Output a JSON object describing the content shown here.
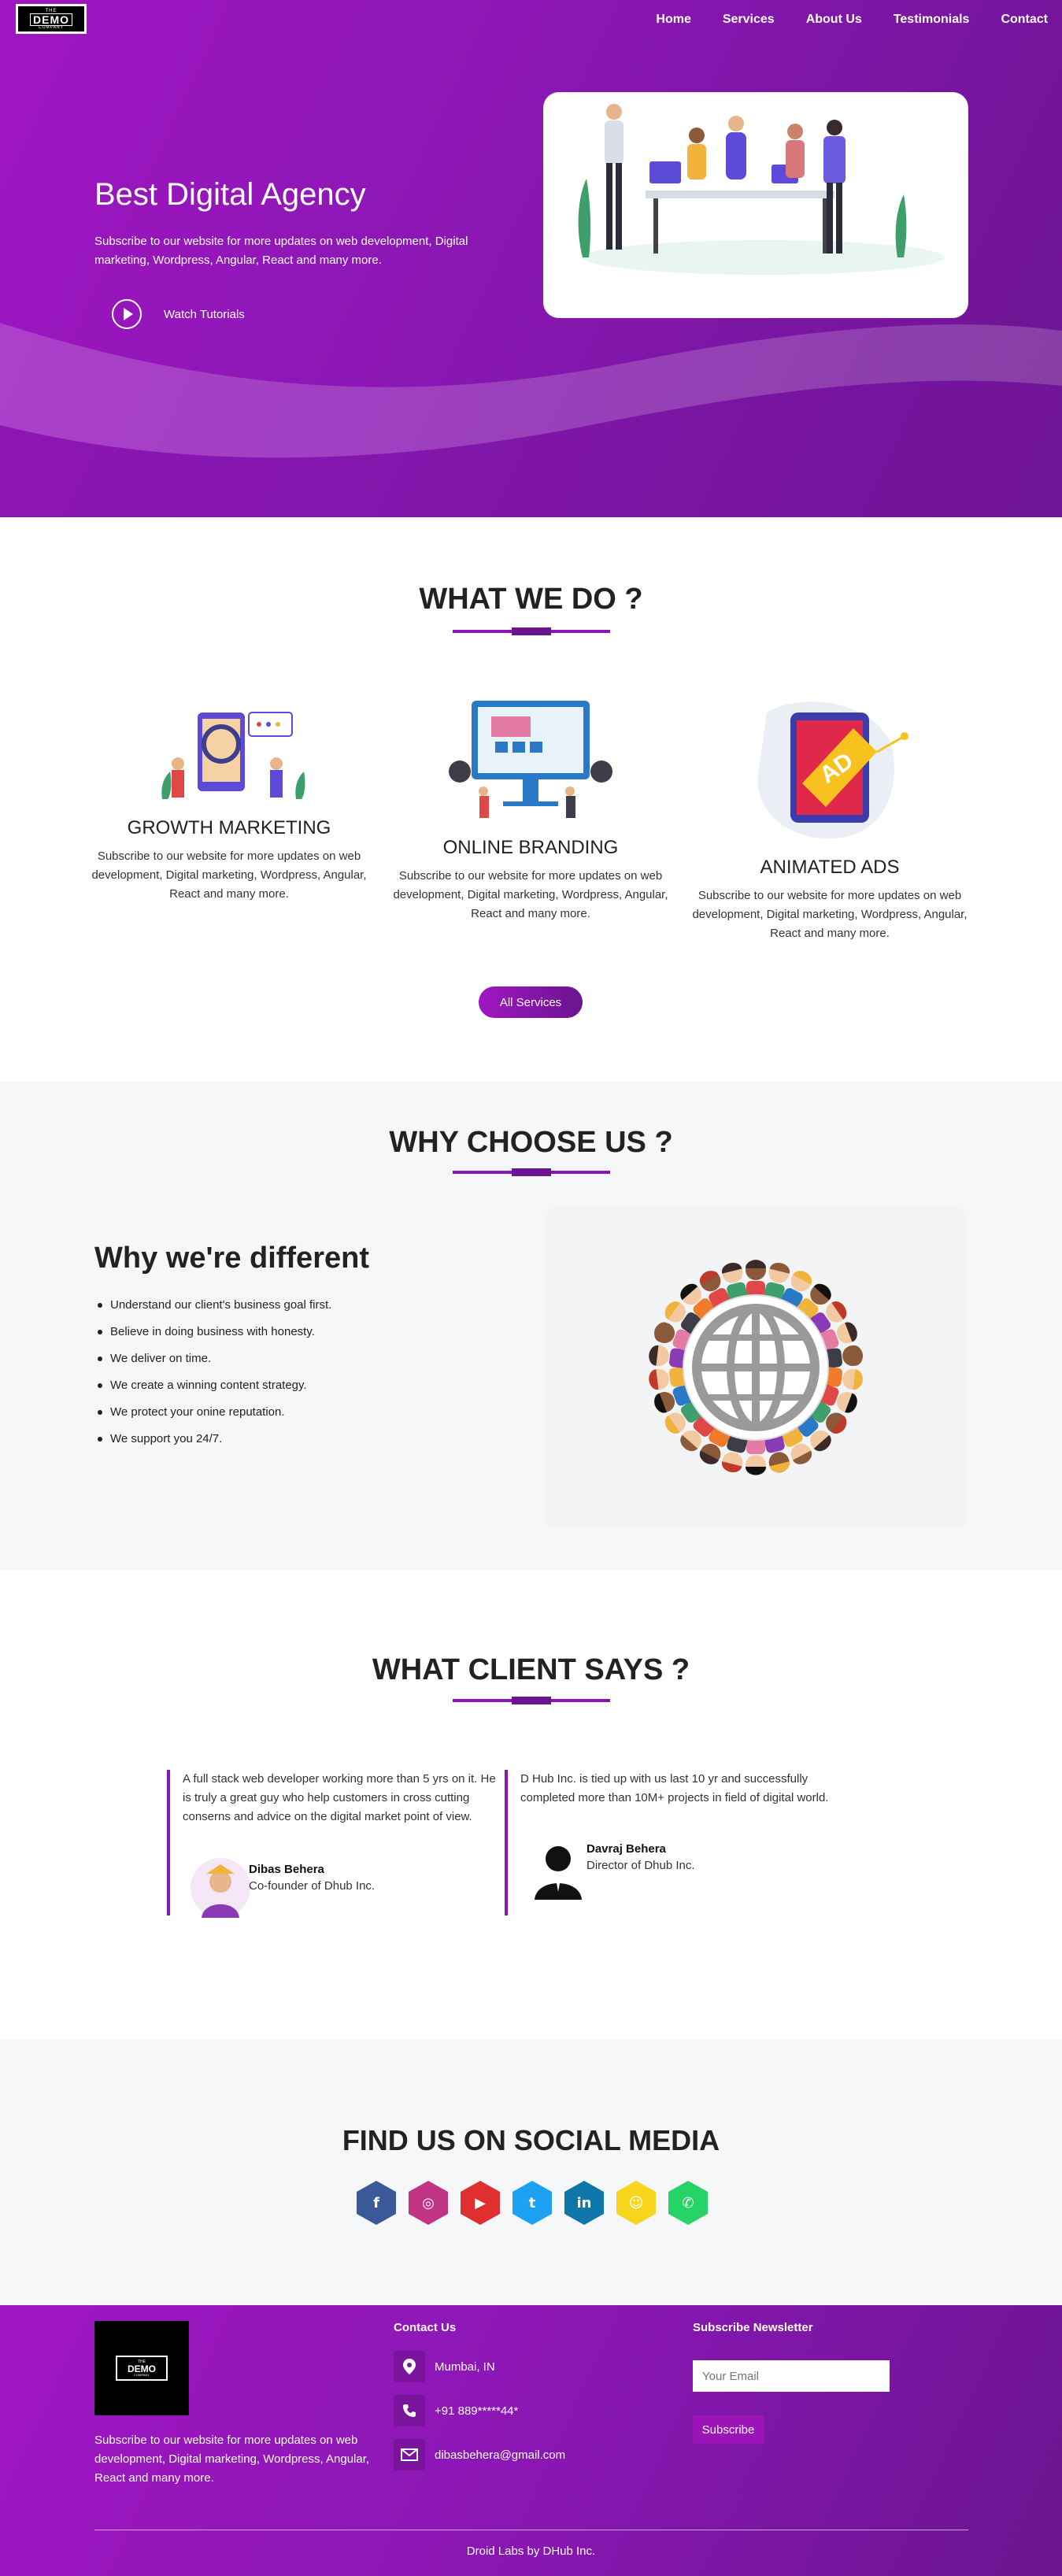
{
  "nav": {
    "logo": {
      "top": "THE",
      "main": "DEMO",
      "bottom": "COMPANY"
    },
    "links": [
      "Home",
      "Services",
      "About Us",
      "Testimonials",
      "Contact"
    ]
  },
  "hero": {
    "title": "Best Digital Agency",
    "subtitle": "Subscribe to our website for more updates on web development, Digital marketing, Wordpress, Angular, React and many more.",
    "watch_label": "Watch Tutorials"
  },
  "services": {
    "heading": "WHAT WE DO ?",
    "items": [
      {
        "title": "GROWTH MARKETING",
        "text": "Subscribe to our website for more updates on web development, Digital marketing, Wordpress, Angular, React and many more."
      },
      {
        "title": "ONLINE BRANDING",
        "text": "Subscribe to our website for more updates on web development, Digital marketing, Wordpress, Angular, React and many more."
      },
      {
        "title": "ANIMATED ADS",
        "text": "Subscribe to our website for more updates on web development, Digital marketing, Wordpress, Angular, React and many more."
      }
    ],
    "ad_label": "AD",
    "button": "All Services"
  },
  "why": {
    "heading": "WHY CHOOSE US ?",
    "title": "Why we're different",
    "points": [
      "Understand our client's business goal first.",
      "Believe in doing business with honesty.",
      "We deliver on time.",
      "We create a winning content strategy.",
      "We protect your onine reputation.",
      "We support you 24/7."
    ]
  },
  "testimonials": {
    "heading": "WHAT CLIENT SAYS ?",
    "items": [
      {
        "text": "A full stack web developer working more than 5 yrs on it. He is truly a great guy who help customers in cross cutting conserns and advice on the digital market point of view.",
        "name": "Dibas Behera",
        "role": "Co-founder of Dhub Inc."
      },
      {
        "text": "D Hub Inc. is tied up with us last 10 yr and successfully completed more than 10M+ projects in field of digital world.",
        "name": "Davraj Behera",
        "role": "Director of Dhub Inc."
      }
    ]
  },
  "social": {
    "heading": "FIND US ON SOCIAL MEDIA",
    "icons": [
      {
        "name": "facebook-icon",
        "color": "#3b5998",
        "glyph": "f"
      },
      {
        "name": "instagram-icon",
        "color": "#c13584",
        "glyph": "◎"
      },
      {
        "name": "youtube-icon",
        "color": "#e02f2f",
        "glyph": "▶"
      },
      {
        "name": "twitter-icon",
        "color": "#1da1f2",
        "glyph": "t"
      },
      {
        "name": "linkedin-icon",
        "color": "#0e76a8",
        "glyph": "in"
      },
      {
        "name": "snapchat-icon",
        "color": "#f7d51d",
        "glyph": "☺"
      },
      {
        "name": "whatsapp-icon",
        "color": "#25d366",
        "glyph": "✆"
      }
    ]
  },
  "footer": {
    "description": "Subscribe to our website for more updates on web development, Digital marketing, Wordpress, Angular, React and many more.",
    "contact_heading": "Contact Us",
    "location": "Mumbai, IN",
    "phone": "+91 889*****44*",
    "email": "dibasbehera@gmail.com",
    "newsletter_heading": "Subscribe Newsletter",
    "email_placeholder": "Your Email",
    "subscribe_button": "Subscribe",
    "copyright": "Droid Labs by DHub Inc."
  },
  "colors": {
    "accent": "#8a17b4",
    "accent_dark": "#6a148f",
    "accent_light": "#a016c2"
  }
}
